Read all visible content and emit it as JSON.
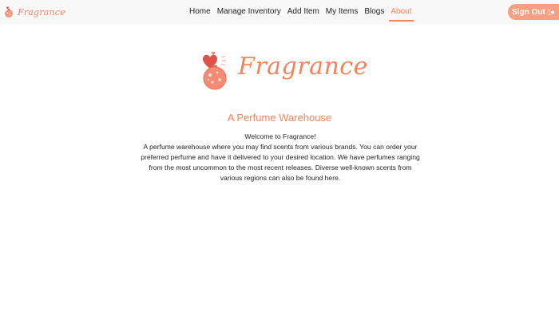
{
  "header": {
    "brand": "Fragrance",
    "nav": [
      {
        "label": "Home"
      },
      {
        "label": "Manage Inventory"
      },
      {
        "label": "Add Item"
      },
      {
        "label": "My Items"
      },
      {
        "label": "Blogs"
      },
      {
        "label": "About",
        "active": true
      }
    ],
    "sign_out_label": "Sign Out",
    "sign_out_icon": "sign-out-icon"
  },
  "main": {
    "logo_text": "Fragrance",
    "heading": "A Perfume Warehouse",
    "welcome": "Welcome to Fragrance!",
    "description": "A perfume warehouse where you may find scents from various brands. You can order your preferred perfume and have it delivered to your desired location. We have perfumes ranging from the most uncommon to the most recent releases. Diverse well-known scents from various regions can also be found here."
  },
  "colors": {
    "accent": "#f0845c",
    "button": "#f7a081",
    "navbar_bg": "#f8f8f9"
  }
}
